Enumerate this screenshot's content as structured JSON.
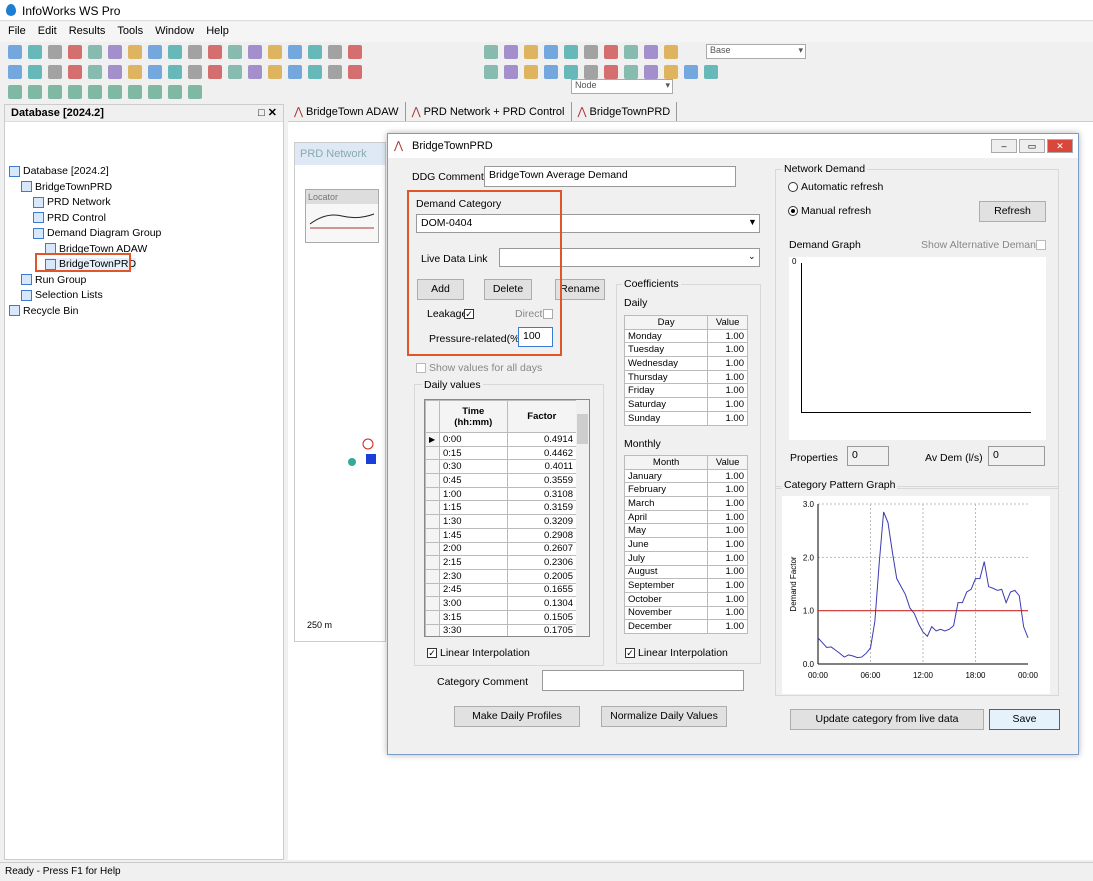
{
  "app": {
    "title": "InfoWorks WS Pro",
    "accent": "#1e7fd0"
  },
  "menu": [
    "File",
    "Edit",
    "Results",
    "Tools",
    "Window",
    "Help"
  ],
  "toolbar": {
    "scenario_combo": "Base",
    "node_combo": "Node"
  },
  "database_panel": {
    "title": "Database [2024.2]",
    "tree": [
      {
        "label": "Database [2024.2]",
        "level": 0,
        "icon": "database-icon"
      },
      {
        "label": "BridgeTownPRD",
        "level": 1,
        "icon": "network-icon"
      },
      {
        "label": "PRD Network",
        "level": 2,
        "icon": "network-icon"
      },
      {
        "label": "PRD Control",
        "level": 2,
        "icon": "control-icon"
      },
      {
        "label": "Demand Diagram Group",
        "level": 2,
        "icon": "folder-icon"
      },
      {
        "label": "BridgeTown ADAW",
        "level": 3,
        "icon": "demand-diagram-icon"
      },
      {
        "label": "BridgeTownPRD",
        "level": 3,
        "icon": "demand-diagram-icon",
        "selected": true
      },
      {
        "label": "Run Group",
        "level": 1,
        "icon": "folder-icon"
      },
      {
        "label": "Selection Lists",
        "level": 1,
        "icon": "folder-icon"
      },
      {
        "label": "Recycle Bin",
        "level": 0,
        "icon": "recycle-bin-icon"
      }
    ]
  },
  "doc_tabs": [
    "BridgeTown ADAW",
    "PRD Network + PRD Control",
    "BridgeTownPRD"
  ],
  "map": {
    "window_title": "PRD Network",
    "locator_title": "Locator",
    "scale": "250 m"
  },
  "status": "Ready - Press F1 for Help",
  "dialog": {
    "title": "BridgeTownPRD",
    "ddg_comment_label": "DDG Comment",
    "ddg_comment": "BridgeTown Average Demand",
    "demand_category_label": "Demand Category",
    "demand_category": "DOM-0404",
    "live_data_link_label": "Live Data Link",
    "live_data_link": "",
    "add": "Add",
    "delete": "Delete",
    "rename": "Rename",
    "leakage_label": "Leakage",
    "leakage": true,
    "direct_label": "Direct",
    "direct": false,
    "pressure_label": "Pressure-related(%)",
    "pressure": "100",
    "show_all_days_label": "Show values for all days",
    "daily_values_label": "Daily values",
    "daily_headers": [
      "Time\n(hh:mm)",
      "Factor"
    ],
    "daily_values": [
      [
        "0:00",
        "0.4914"
      ],
      [
        "0:15",
        "0.4462"
      ],
      [
        "0:30",
        "0.4011"
      ],
      [
        "0:45",
        "0.3559"
      ],
      [
        "1:00",
        "0.3108"
      ],
      [
        "1:15",
        "0.3159"
      ],
      [
        "1:30",
        "0.3209"
      ],
      [
        "1:45",
        "0.2908"
      ],
      [
        "2:00",
        "0.2607"
      ],
      [
        "2:15",
        "0.2306"
      ],
      [
        "2:30",
        "0.2005"
      ],
      [
        "2:45",
        "0.1655"
      ],
      [
        "3:00",
        "0.1304"
      ],
      [
        "3:15",
        "0.1505"
      ],
      [
        "3:30",
        "0.1705"
      ]
    ],
    "linear_interp_label": "Linear Interpolation",
    "coefficients_label": "Coefficients",
    "daily_label": "Daily",
    "monthly_label": "Monthly",
    "day_headers": [
      "Day",
      "Value"
    ],
    "days": [
      [
        "Monday",
        "1.00"
      ],
      [
        "Tuesday",
        "1.00"
      ],
      [
        "Wednesday",
        "1.00"
      ],
      [
        "Thursday",
        "1.00"
      ],
      [
        "Friday",
        "1.00"
      ],
      [
        "Saturday",
        "1.00"
      ],
      [
        "Sunday",
        "1.00"
      ]
    ],
    "month_headers": [
      "Month",
      "Value"
    ],
    "months": [
      [
        "January",
        "1.00"
      ],
      [
        "February",
        "1.00"
      ],
      [
        "March",
        "1.00"
      ],
      [
        "April",
        "1.00"
      ],
      [
        "May",
        "1.00"
      ],
      [
        "June",
        "1.00"
      ],
      [
        "July",
        "1.00"
      ],
      [
        "August",
        "1.00"
      ],
      [
        "September",
        "1.00"
      ],
      [
        "October",
        "1.00"
      ],
      [
        "November",
        "1.00"
      ],
      [
        "December",
        "1.00"
      ]
    ],
    "category_comment_label": "Category Comment",
    "category_comment": "",
    "make_daily_profiles": "Make Daily Profiles",
    "normalize": "Normalize Daily Values",
    "network_demand_label": "Network Demand",
    "auto_refresh": "Automatic refresh",
    "manual_refresh": "Manual refresh",
    "refresh_mode": "manual",
    "refresh": "Refresh",
    "demand_graph_label": "Demand Graph",
    "show_alt_demand": "Show Alternative Demand",
    "demand_graph_ytick": "0",
    "properties_label": "Properties",
    "properties": "0",
    "av_dem_label": "Av Dem (l/s)",
    "av_dem": "0",
    "pattern_graph_label": "Category Pattern Graph",
    "update_category": "Update category from live data",
    "save": "Save"
  },
  "chart_data": {
    "type": "line",
    "ylabel": "Demand Factor",
    "ylim": [
      0,
      3
    ],
    "yticks": [
      "0.0",
      "1.0",
      "2.0",
      "3.0"
    ],
    "xticks": [
      "00:00",
      "06:00",
      "12:00",
      "18:00",
      "00:00"
    ],
    "grid": true,
    "x_hours": [
      0,
      0.5,
      1,
      1.5,
      2,
      2.5,
      3,
      3.5,
      4,
      4.5,
      5,
      5.5,
      6,
      6.5,
      7,
      7.5,
      8,
      8.5,
      9,
      9.5,
      10,
      10.5,
      11,
      11.5,
      12,
      12.5,
      13,
      13.5,
      14,
      14.5,
      15,
      15.5,
      16,
      16.5,
      17,
      17.5,
      18,
      18.5,
      19,
      19.5,
      20,
      20.5,
      21,
      21.5,
      22,
      22.5,
      23,
      23.5,
      24
    ],
    "series": [
      {
        "values": [
          0.49,
          0.4,
          0.31,
          0.32,
          0.26,
          0.2,
          0.13,
          0.17,
          0.15,
          0.12,
          0.13,
          0.2,
          0.3,
          0.8,
          1.9,
          2.85,
          2.65,
          2.1,
          1.6,
          1.45,
          1.3,
          1.05,
          0.95,
          0.75,
          0.6,
          0.52,
          0.7,
          0.62,
          0.65,
          0.62,
          0.65,
          0.72,
          1.15,
          1.15,
          1.35,
          1.4,
          1.6,
          1.6,
          1.92,
          1.45,
          1.42,
          1.38,
          1.4,
          1.15,
          1.35,
          1.38,
          1.28,
          0.7,
          0.49
        ],
        "color": "#3b3bb0"
      }
    ],
    "reference_line": {
      "y": 1.0,
      "color": "#d03030"
    }
  }
}
